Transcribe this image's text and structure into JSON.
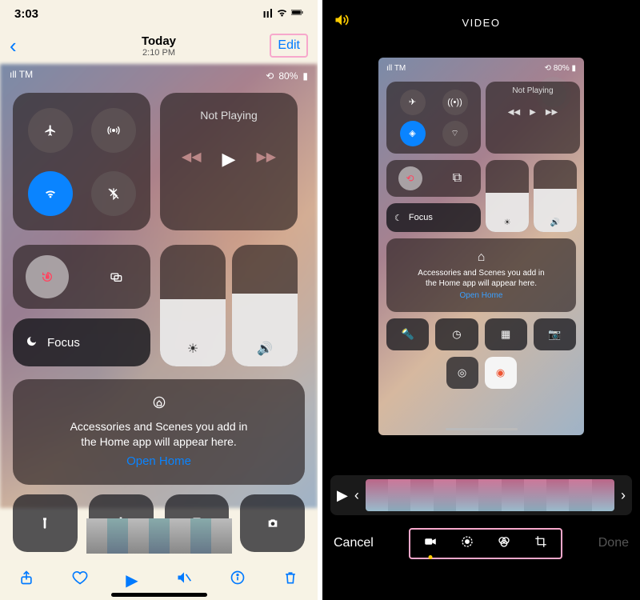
{
  "left": {
    "status": {
      "time": "3:03",
      "signal": "••ıl",
      "wifi": "wifi",
      "battery": "100"
    },
    "header": {
      "title": "Today",
      "subtitle": "2:10 PM",
      "edit": "Edit"
    },
    "cc": {
      "carrier": "TM",
      "battery": "80%",
      "media": {
        "title": "Not Playing"
      },
      "focus": "Focus",
      "brightness_pct": 55,
      "volume_pct": 60,
      "home": {
        "line1": "Accessories and Scenes you add in",
        "line2": "the Home app will appear here.",
        "open": "Open Home"
      }
    },
    "toolbar_icons": [
      "share",
      "favorite",
      "play",
      "mute",
      "info",
      "trash"
    ]
  },
  "right": {
    "title": "VIDEO",
    "cc": {
      "carrier": "TM",
      "battery": "80%",
      "media": {
        "title": "Not Playing"
      },
      "focus": "Focus",
      "brightness_pct": 55,
      "volume_pct": 60,
      "home": {
        "line1": "Accessories and Scenes you add in",
        "line2": "the Home app will appear here.",
        "open": "Open Home"
      }
    },
    "footer": {
      "cancel": "Cancel",
      "done": "Done"
    }
  }
}
